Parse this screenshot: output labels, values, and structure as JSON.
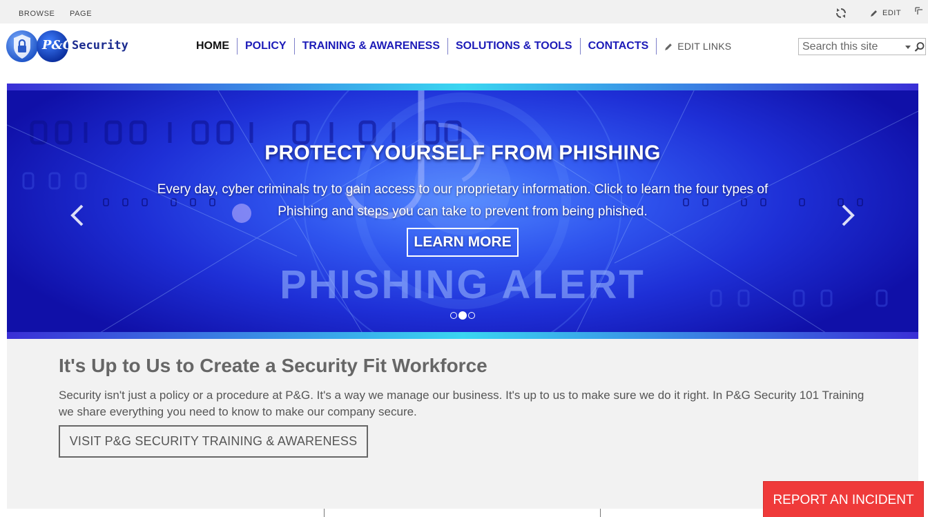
{
  "ribbon": {
    "tabs": [
      "BROWSE",
      "PAGE"
    ],
    "edit_label": "EDIT",
    "icons": {
      "sync": "sync-icon",
      "edit": "pencil-icon",
      "focus": "focus-content-icon"
    }
  },
  "header": {
    "logo": {
      "brand": "P&G",
      "name": "Security",
      "icon": "shield-lock-icon"
    },
    "nav": [
      {
        "label": "HOME",
        "active": true
      },
      {
        "label": "POLICY",
        "active": false
      },
      {
        "label": "TRAINING & AWARENESS",
        "active": false
      },
      {
        "label": "SOLUTIONS & TOOLS",
        "active": false
      },
      {
        "label": "CONTACTS",
        "active": false
      }
    ],
    "edit_links_label": "EDIT LINKS",
    "search": {
      "placeholder": "Search this site",
      "value": ""
    }
  },
  "carousel": {
    "title": "PROTECT YOURSELF FROM PHISHING",
    "body": "Every day, cyber criminals try to gain access to our proprietary information. Click to learn the four types of Phishing and steps you can take to prevent from being phished.",
    "button_label": "LEARN MORE",
    "image_text": "PHISHING ALERT",
    "slide_count": 3,
    "active_slide": 2,
    "colors": {
      "accent": "#39d6f1",
      "deep": "#1010a8"
    }
  },
  "main": {
    "heading": "It's Up to Us to Create a Security Fit Workforce",
    "body": "Security isn't just a policy or a procedure at P&G. It's a way we manage our business. It's up to us to make sure we do it right. In P&G Security 101 Training we share everything you need to know to make our company secure.",
    "button_label": "VISIT P&G SECURITY TRAINING & AWARENESS"
  },
  "report_button": {
    "label": "REPORT AN INCIDENT",
    "color": "#ef3a3a"
  }
}
